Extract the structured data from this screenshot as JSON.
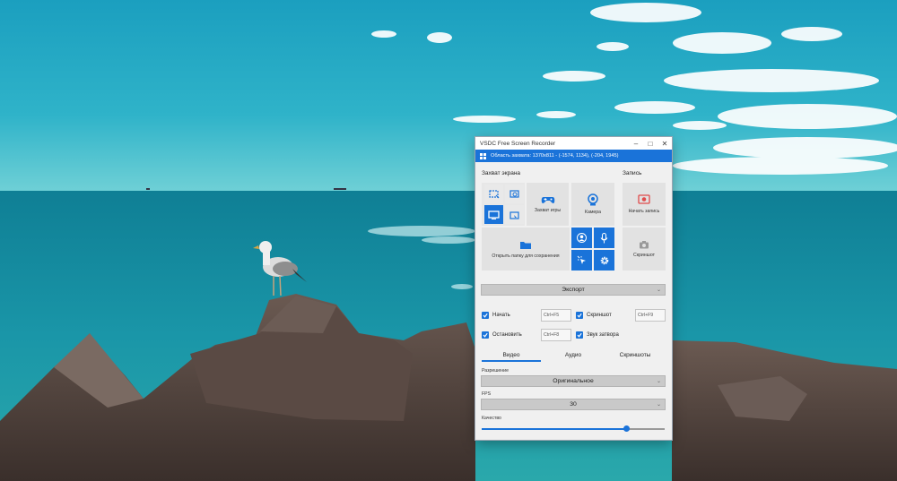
{
  "window": {
    "title": "VSDC Free Screen Recorder",
    "capture_area": "Область захвата: 1370x811 - (-1574, 1134), (-204, 1945)"
  },
  "capture_section": {
    "label": "Захват экрана",
    "game_capture_label": "Захват игры",
    "camera_label": "Камера",
    "open_folder_label": "Открыть папку для сохранения"
  },
  "record_section": {
    "label": "Запись",
    "start_record_label": "Начать запись",
    "screenshot_label": "Скриншот"
  },
  "export": {
    "label": "Экспорт"
  },
  "hotkeys": {
    "start_label": "Начать",
    "start_key": "Ctrl+F5",
    "stop_label": "Остановить",
    "stop_key": "Ctrl+F8",
    "screenshot_label": "Скриншот",
    "screenshot_key": "Ctrl+F9",
    "shutter_label": "Звук затвора"
  },
  "tabs": [
    "Видео",
    "Аудио",
    "Скриншоты"
  ],
  "video": {
    "resolution_label": "Разрешение",
    "resolution_value": "Оригинальное",
    "fps_label": "FPS",
    "fps_value": "30",
    "quality_label": "Качество",
    "quality_value": 0.79
  },
  "colors": {
    "accent": "#1a73d9",
    "sky": "#1fa5c4",
    "sea": "#138fa4"
  },
  "icons": [
    "minimize-icon",
    "maximize-icon",
    "close-icon",
    "windows-logo-icon",
    "region-capture-icon",
    "zoom-capture-icon",
    "monitor-icon",
    "window-capture-icon",
    "gamepad-icon",
    "webcam-icon",
    "record-icon",
    "camera-icon",
    "folder-icon",
    "user-icon",
    "microphone-icon",
    "cursor-icon",
    "gear-icon",
    "check-icon",
    "chevron-down-icon"
  ]
}
